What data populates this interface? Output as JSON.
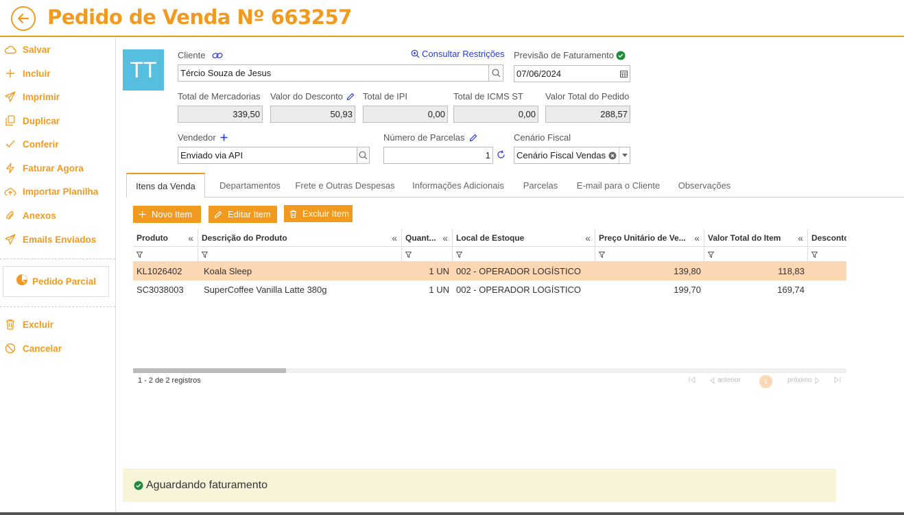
{
  "header": {
    "title": "Pedido de Venda Nº 663257"
  },
  "sidebar": {
    "items": [
      {
        "label": "Salvar",
        "icon": "cloud-icon"
      },
      {
        "label": "Incluir",
        "icon": "plus-icon"
      },
      {
        "label": "Imprimir",
        "icon": "send-icon"
      },
      {
        "label": "Duplicar",
        "icon": "copy-icon"
      },
      {
        "label": "Conferir",
        "icon": "check-icon"
      },
      {
        "label": "Faturar Agora",
        "icon": "bolt-icon"
      },
      {
        "label": "Importar Planilha",
        "icon": "upload-icon"
      },
      {
        "label": "Anexos",
        "icon": "paperclip-icon"
      },
      {
        "label": "Emails Enviados",
        "icon": "send-icon"
      }
    ],
    "partial": "Pedido Parcial",
    "bottom_items": [
      {
        "label": "Excluir",
        "icon": "trash-icon"
      },
      {
        "label": "Cancelar",
        "icon": "cancel-icon"
      }
    ]
  },
  "form": {
    "avatar": "TT",
    "cliente_label": "Cliente",
    "cliente_value": "Tércio Souza de Jesus",
    "consultar": "Consultar Restrições",
    "previsao_label": "Previsão de Faturamento",
    "previsao_value": "07/06/2024",
    "totals": [
      {
        "label": "Total de Mercadorias",
        "value": "339,50"
      },
      {
        "label": "Valor do Desconto",
        "value": "50,93"
      },
      {
        "label": "Total de IPI",
        "value": "0,00"
      },
      {
        "label": "Total de ICMS ST",
        "value": "0,00"
      },
      {
        "label": "Valor Total do Pedido",
        "value": "288,57"
      }
    ],
    "vendedor_label": "Vendedor",
    "vendedor_value": "Enviado via API",
    "parcelas_label": "Número de Parcelas",
    "parcelas_value": "1",
    "cenario_label": "Cenário Fiscal",
    "cenario_value": "Cenário Fiscal Vendas"
  },
  "tabs": [
    "Itens da Venda",
    "Departamentos",
    "Frete e Outras Despesas",
    "Informações Adicionais",
    "Parcelas",
    "E-mail para o Cliente",
    "Observações"
  ],
  "toolbar": {
    "novo": "Novo Item",
    "editar": "Editar Item",
    "excluir": "Excluir Item"
  },
  "grid": {
    "columns": [
      "Produto",
      "Descrição do Produto",
      "Quant...",
      "Local de Estoque",
      "Preço Unitário de Ve...",
      "Valor Total do Item",
      "Desconto"
    ],
    "rows": [
      {
        "produto": "KL1026402",
        "descricao": "Koala Sleep",
        "quant": "1 UN",
        "local": "002 - OPERADOR LOGÍSTICO",
        "preco": "139,80",
        "total": "118,83"
      },
      {
        "produto": "SC3038003",
        "descricao": "SuperCoffee Vanilla Latte 380g",
        "quant": "1 UN",
        "local": "002 - OPERADOR LOGÍSTICO",
        "preco": "199,70",
        "total": "169,74"
      }
    ],
    "records": "1 - 2 de 2 registros",
    "prev": "anterior",
    "next": "próximo",
    "page": "1"
  },
  "status": {
    "text": "Aguardando faturamento"
  },
  "colors": {
    "accent": "#f29a1f",
    "avatar": "#56bedf",
    "selected_row": "#fbd7b3",
    "status_bg": "#f8f4da",
    "ok": "#1e8c3a"
  }
}
